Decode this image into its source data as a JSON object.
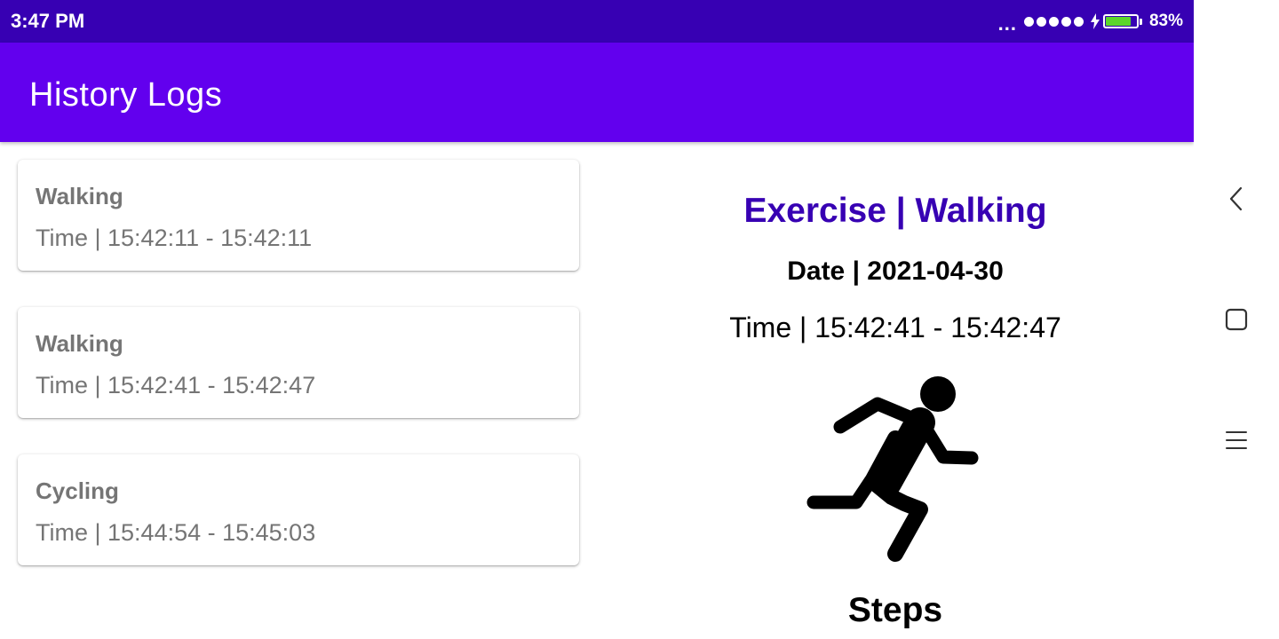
{
  "status_bar": {
    "time": "3:47 PM",
    "more": "...",
    "signal_icon": "signal-dots-icon",
    "charging_icon": "lightning-icon",
    "battery_percent": "83%",
    "battery_level": 0.83,
    "battery_color": "#5bd62a"
  },
  "app_bar": {
    "title": "History Logs",
    "color": "#6200ee"
  },
  "logs": [
    {
      "type": "Walking",
      "time": "Time | 15:42:11 - 15:42:11"
    },
    {
      "type": "Walking",
      "time": "Time | 15:42:41 - 15:42:47"
    },
    {
      "type": "Cycling",
      "time": "Time | 15:44:54 - 15:45:03"
    }
  ],
  "detail": {
    "title": "Exercise | Walking",
    "date": "Date | 2021-04-30",
    "time": "Time | 15:42:41 - 15:42:47",
    "icon": "running-person-icon",
    "metric_label": "Steps",
    "title_color": "#3700b3"
  },
  "nav": {
    "back_icon": "back-chevron-icon",
    "home_icon": "square-home-icon",
    "menu_icon": "hamburger-menu-icon"
  }
}
